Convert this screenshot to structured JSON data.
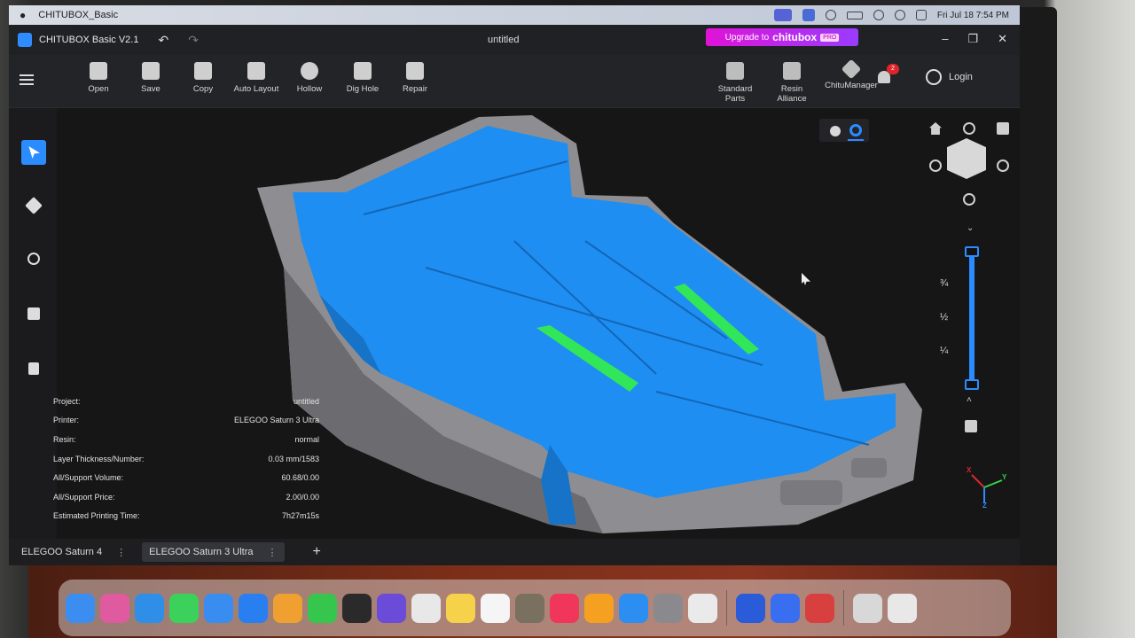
{
  "menubar": {
    "app_name": "CHITUBOX_Basic",
    "datetime": "Fri Jul 18  7:54 PM"
  },
  "titlebar": {
    "app_version": "CHITUBOX Basic V2.1",
    "document": "untitled",
    "upgrade_label": "Upgrade to",
    "upgrade_brand": "chitubox",
    "upgrade_tag": "PRO",
    "accent": "#2b8cff"
  },
  "toolbar": {
    "left_tools": [
      {
        "label": "Open",
        "icon": "folder-icon"
      },
      {
        "label": "Save",
        "icon": "save-icon"
      },
      {
        "label": "Copy",
        "icon": "copy-icon"
      },
      {
        "label": "Auto Layout",
        "icon": "auto-layout-icon"
      },
      {
        "label": "Hollow",
        "icon": "hollow-icon"
      },
      {
        "label": "Dig Hole",
        "icon": "dig-hole-icon"
      },
      {
        "label": "Repair",
        "icon": "repair-icon"
      }
    ],
    "right_tools": [
      {
        "label": "Standard\nParts",
        "icon": "parts-icon"
      },
      {
        "label": "Resin\nAlliance",
        "icon": "resin-icon"
      },
      {
        "label": "ChituManager",
        "icon": "manager-icon"
      }
    ],
    "notification_count": "2",
    "login_label": "Login"
  },
  "left_tools": [
    "select-icon",
    "move-icon",
    "rotate-icon",
    "scale-icon",
    "mirror-icon"
  ],
  "slider": {
    "marks": [
      "¾",
      "½",
      "¼"
    ]
  },
  "axes": {
    "x": "X",
    "y": "Y",
    "z": "Z"
  },
  "info": {
    "rows": [
      {
        "label": "Project:",
        "value": "untitled"
      },
      {
        "label": "Printer:",
        "value": "ELEGOO Saturn 3 Ultra"
      },
      {
        "label": "Resin:",
        "value": "normal"
      },
      {
        "label": "Layer Thickness/Number:",
        "value": "0.03 mm/1583"
      },
      {
        "label": "All/Support Volume:",
        "value": "60.68/0.00"
      },
      {
        "label": "All/Support Price:",
        "value": "2.00/0.00"
      },
      {
        "label": "Estimated Printing Time:",
        "value": "7h27m15s"
      }
    ]
  },
  "printer_tabs": [
    {
      "label": "ELEGOO Saturn 4",
      "active": false
    },
    {
      "label": "ELEGOO Saturn 3 Ultra",
      "active": true
    }
  ],
  "add_tab": "+",
  "model_colors": {
    "body": "#1e8ef2",
    "support": "#32e65a",
    "shell": "#8e8e92"
  },
  "dock": {
    "apps": [
      {
        "name": "finder-icon",
        "color": "#3b8ef0"
      },
      {
        "name": "launchpad-icon",
        "color": "#e05aa0"
      },
      {
        "name": "safari-icon",
        "color": "#2f8fe8"
      },
      {
        "name": "messages-icon",
        "color": "#3bd15a"
      },
      {
        "name": "mail-icon",
        "color": "#3a8df0"
      },
      {
        "name": "copilot-icon",
        "color": "#2a7ff0"
      },
      {
        "name": "photos-icon",
        "color": "#f0a030"
      },
      {
        "name": "facetime-icon",
        "color": "#37c64d"
      },
      {
        "name": "orbit-icon",
        "color": "#2a2a2a"
      },
      {
        "name": "imovie-icon",
        "color": "#6a4cd8"
      },
      {
        "name": "chrome-icon",
        "color": "#e8e8e8"
      },
      {
        "name": "notes-icon",
        "color": "#f5d24a"
      },
      {
        "name": "freeform-icon",
        "color": "#f5f5f5"
      },
      {
        "name": "gimp-icon",
        "color": "#7a7060"
      },
      {
        "name": "music-icon",
        "color": "#f0365a"
      },
      {
        "name": "pages-icon",
        "color": "#f5a020"
      },
      {
        "name": "appstore-icon",
        "color": "#2c8ef0"
      },
      {
        "name": "settings-icon",
        "color": "#8a8a8e"
      },
      {
        "name": "iphone-mirror-icon",
        "color": "#eaeaea"
      },
      {
        "name": "chitubox-icon",
        "color": "#2a5bd8"
      },
      {
        "name": "chitu-manager-icon",
        "color": "#3a6ef0"
      },
      {
        "name": "eraser-icon",
        "color": "#d84040"
      },
      {
        "name": "screen-icon",
        "color": "#d8d8d8"
      },
      {
        "name": "trash-icon",
        "color": "#e8e8e8"
      }
    ]
  }
}
